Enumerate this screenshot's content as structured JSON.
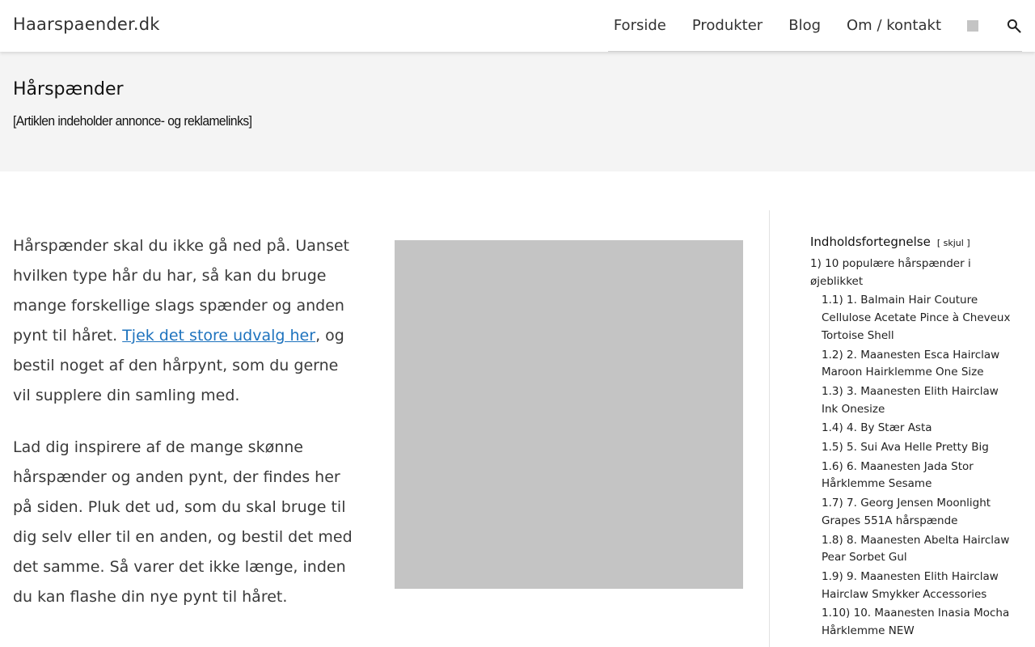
{
  "header": {
    "site_title": "Haarspaender.dk",
    "nav": [
      {
        "label": "Forside"
      },
      {
        "label": "Produkter"
      },
      {
        "label": "Blog"
      },
      {
        "label": "Om / kontakt"
      }
    ],
    "icons": [
      "placeholder-square-icon",
      "search-icon"
    ]
  },
  "page": {
    "title": "Hårspænder",
    "ad_notice": "[Artiklen indeholder annonce- og reklamelinks]"
  },
  "content": {
    "p1_before": "Hårspænder skal du ikke gå ned på. Uanset hvilken type hår du har, så kan du bruge mange forskellige slags spænder og anden pynt til håret. ",
    "p1_link": "Tjek det store udvalg her",
    "p1_after": ", og bestil noget af den hårpynt, som du gerne vil supplere din samling med.",
    "p2": "Lad dig inspirere af de mange skønne hårspænder og anden pynt, der findes her på siden. Pluk det ud, som du skal bruge til dig selv eller til en anden, og bestil det med det samme. Så varer det ikke længe, inden du kan flashe din nye pynt til håret."
  },
  "toc": {
    "title": "Indholdsfortegnelse",
    "toggle": "[ skjul ]",
    "items": [
      {
        "label": "1) 10 populære hårspænder i øjeblikket",
        "sub": false
      },
      {
        "label": "1.1) 1. Balmain Hair Couture Cellulose Acetate Pince à Cheveux Tortoise Shell",
        "sub": true
      },
      {
        "label": "1.2) 2. Maanesten Esca Hairclaw Maroon Hairklemme One Size",
        "sub": true
      },
      {
        "label": "1.3) 3. Maanesten Elith Hairclaw Ink Onesize",
        "sub": true
      },
      {
        "label": "1.4) 4. By Stær Asta",
        "sub": true
      },
      {
        "label": "1.5) 5. Sui Ava Helle Pretty Big",
        "sub": true
      },
      {
        "label": "1.6) 6. Maanesten Jada Stor Hårklemme Sesame",
        "sub": true
      },
      {
        "label": "1.7) 7. Georg Jensen Moonlight Grapes 551A hårspænde",
        "sub": true
      },
      {
        "label": "1.8) 8. Maanesten Abelta Hairclaw Pear Sorbet Gul",
        "sub": true
      },
      {
        "label": "1.9) 9. Maanesten Elith Hairclaw Hairclaw Smykker Accessories",
        "sub": true
      },
      {
        "label": "1.10) 10. Maanesten Inasia Mocha Hårklemme NEW",
        "sub": true
      }
    ]
  },
  "colors": {
    "link": "#1e73be",
    "title_band_bg": "#f4f4f4",
    "image_placeholder": "#c4c4c4"
  }
}
